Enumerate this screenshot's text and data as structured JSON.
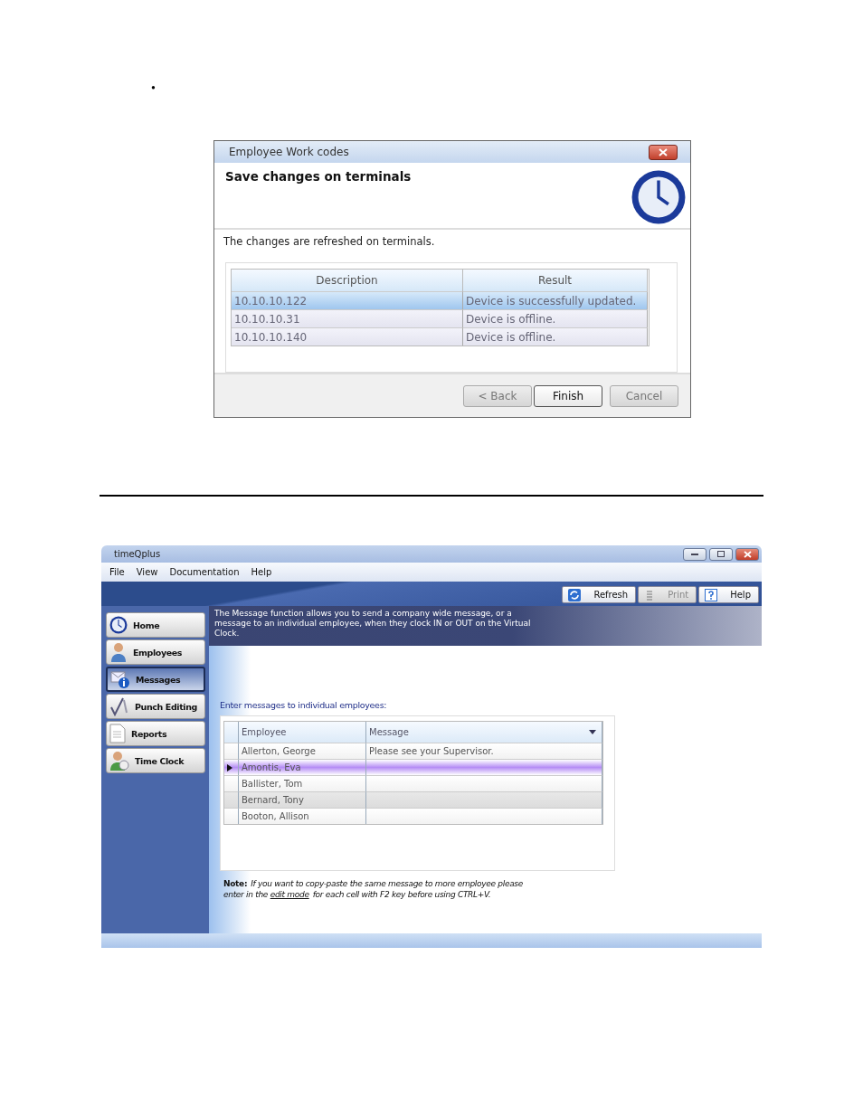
{
  "bullet": "•",
  "dialog": {
    "title": "Employee Work codes",
    "heading": "Save changes on terminals",
    "message": "The changes are refreshed on terminals.",
    "columns": [
      "Description",
      "Result"
    ],
    "rows": [
      {
        "cells": [
          "10.10.10.122",
          "Device is successfully updated."
        ],
        "selected": true
      },
      {
        "cells": [
          "10.10.10.31",
          "Device is offline."
        ],
        "selected": false
      },
      {
        "cells": [
          "10.10.10.140",
          "Device is offline."
        ],
        "selected": false
      }
    ],
    "buttons": [
      {
        "label": "< Back",
        "disabled": true,
        "default": false
      },
      {
        "label": "Finish",
        "disabled": false,
        "default": true
      },
      {
        "label": "Cancel",
        "disabled": true,
        "default": false
      }
    ]
  },
  "app": {
    "title": "timeQplus",
    "menu": [
      "File",
      "View",
      "Documentation",
      "Help"
    ],
    "toolbar": [
      {
        "label": "Refresh",
        "disabled": false
      },
      {
        "label": "Print",
        "disabled": true
      },
      {
        "label": "Help",
        "disabled": false
      }
    ],
    "sidebar": [
      {
        "label": "Home",
        "selected": false
      },
      {
        "label": "Employees",
        "selected": false
      },
      {
        "label": "Messages",
        "selected": true
      },
      {
        "label": "Punch Editing",
        "selected": false
      },
      {
        "label": "Reports",
        "selected": false
      },
      {
        "label": "Time Clock",
        "selected": false
      }
    ],
    "banner": "The Message function allows you to send a company wide message, or a message to an individual employee, when they clock IN or OUT on the Virtual Clock.",
    "prompt": "Enter messages to individual employees:",
    "columns": [
      "Employee",
      "Message"
    ],
    "rows": [
      {
        "employee": "Allerton, George",
        "message": "Please see your Supervisor.",
        "selected": false
      },
      {
        "employee": "Amontis, Eva",
        "selected": true
      },
      {
        "employee": "Ballister, Tom",
        "selected": false
      },
      {
        "employee": "Bernard, Tony",
        "selected": false
      },
      {
        "employee": "Booton, Allison",
        "selected": false
      }
    ],
    "note": {
      "label": "Note:",
      "before": "If you want to copy-paste the same message to more employee please enter in the",
      "link": "edit mode",
      "after": "for each cell with F2 key before using CTRL+V."
    }
  }
}
